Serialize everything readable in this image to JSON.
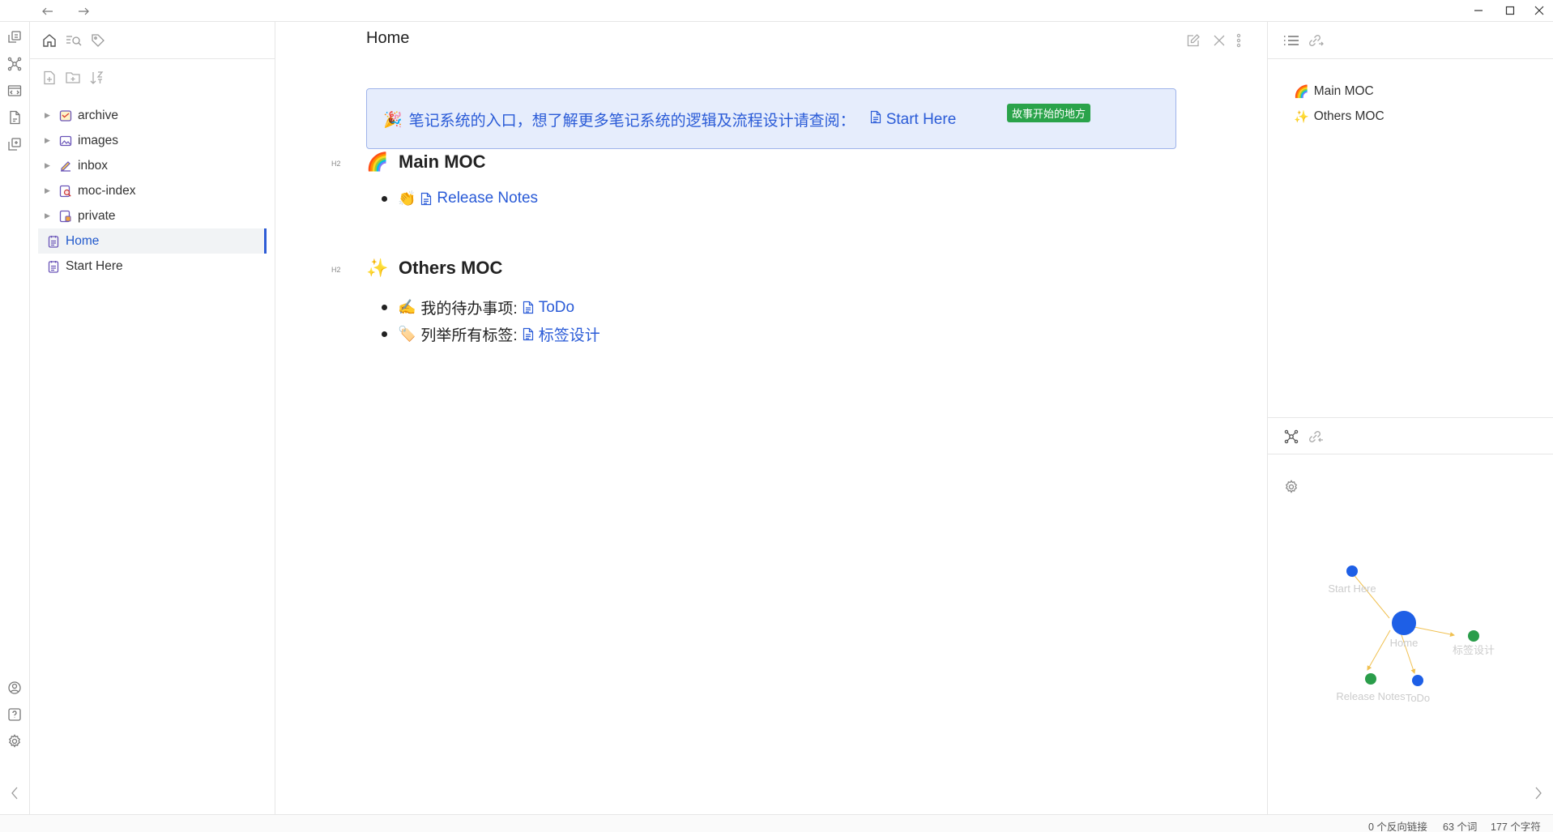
{
  "titlebar": {
    "back_icon": "arrow-left-icon",
    "forward_icon": "arrow-right-icon",
    "window_controls": [
      "minimize-icon",
      "maximize-icon",
      "close-icon"
    ]
  },
  "ribbon": {
    "top_icons": [
      "open-switcher-icon",
      "graph-view-icon",
      "command-palette-icon",
      "daily-note-icon",
      "templates-icon"
    ],
    "bottom_icons": [
      "vault-switch-icon",
      "help-icon",
      "settings-icon"
    ]
  },
  "sidebar": {
    "tabs": [
      "files-icon",
      "search-icon",
      "tags-icon"
    ],
    "actions": [
      "new-note-icon",
      "new-folder-icon",
      "sort-icon"
    ],
    "folders": [
      {
        "label": "archive",
        "icon": "archive-folder-icon"
      },
      {
        "label": "images",
        "icon": "images-folder-icon"
      },
      {
        "label": "inbox",
        "icon": "inbox-folder-icon"
      },
      {
        "label": "moc-index",
        "icon": "moc-folder-icon"
      },
      {
        "label": "private",
        "icon": "private-folder-icon"
      }
    ],
    "files": [
      {
        "label": "Home",
        "active": true
      },
      {
        "label": "Start Here",
        "active": false
      }
    ]
  },
  "editor": {
    "title": "Home",
    "actions": [
      "edit-icon",
      "close-icon",
      "more-icon"
    ],
    "callout": {
      "emoji": "🎉",
      "text": "笔记系统的入口，想了解更多笔记系统的逻辑及流程设计请查阅：",
      "link": "Start Here",
      "tag": "故事开始的地方"
    },
    "sections": [
      {
        "marker": "H2",
        "emoji": "🌈",
        "heading": "Main MOC",
        "items": [
          {
            "emoji": "👏",
            "prefix": "",
            "link": "Release Notes"
          }
        ]
      },
      {
        "marker": "H2",
        "emoji": "✨",
        "heading": "Others MOC",
        "items": [
          {
            "emoji": "✍️",
            "prefix": "我的待办事项: ",
            "link": "ToDo"
          },
          {
            "emoji": "🏷️",
            "prefix": "列举所有标签: ",
            "link": "标签设计"
          }
        ]
      }
    ]
  },
  "outline": {
    "tabs": [
      "outline-icon",
      "backlinks-icon"
    ],
    "items": [
      {
        "emoji": "🌈",
        "label": "Main MOC"
      },
      {
        "emoji": "✨",
        "label": "Others MOC"
      }
    ]
  },
  "graph": {
    "tabs": [
      "local-graph-icon",
      "outgoing-links-icon"
    ],
    "settings_icon": "settings-icon",
    "nodes": [
      {
        "label": "Home",
        "color": "#1e5fe6",
        "size": "large"
      },
      {
        "label": "Start Here",
        "color": "#1e5fe6",
        "size": "small"
      },
      {
        "label": "标签设计",
        "color": "#2a9d4a",
        "size": "small"
      },
      {
        "label": "Release Notes",
        "color": "#2a9d4a",
        "size": "small"
      },
      {
        "label": "ToDo",
        "color": "#1e5fe6",
        "size": "small"
      }
    ],
    "edge_color": "#f0c050"
  },
  "status": {
    "backlinks": "0 个反向链接",
    "words": "63 个词",
    "chars": "177 个字符"
  },
  "colors": {
    "accent": "#2a5bd7",
    "callout_bg": "#e6edfc",
    "tag_bg": "#2aa34a"
  }
}
